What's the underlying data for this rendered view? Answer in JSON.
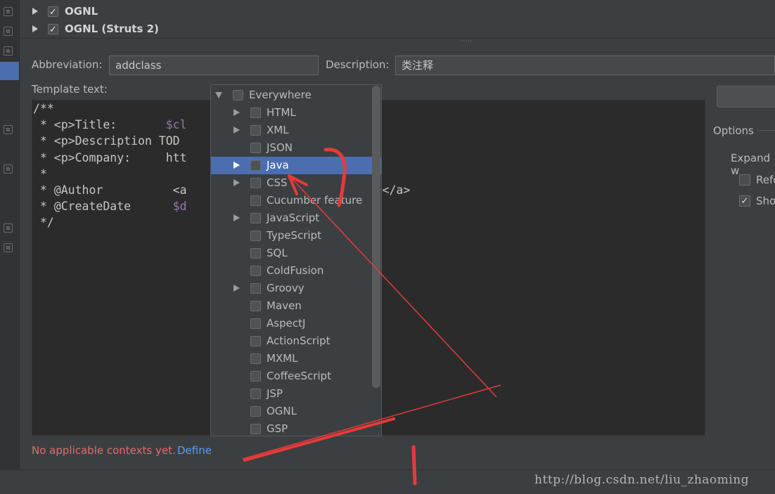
{
  "tree": {
    "items": [
      {
        "label": "OGNL",
        "checked": true
      },
      {
        "label": "OGNL (Struts 2)",
        "checked": true
      }
    ]
  },
  "form": {
    "abbreviation_label": "Abbreviation:",
    "abbreviation_value": "addclass",
    "description_label": "Description:",
    "description_value": "类注释",
    "template_label": "Template text:"
  },
  "editor": {
    "lines": [
      "/**",
      " * <p>Title:       $cl",
      " * <p>Description TOD",
      " * <p>Company:     htt                      </p>",
      " *",
      " * @Author          <a             sina.cn\"/>刘兆明</a>",
      " * @CreateDate      $d",
      " */"
    ],
    "variable_prefix_title": "$cl",
    "variable_prefix_date": "$d"
  },
  "options": {
    "title": "Options",
    "expand_label": "Expand w",
    "reformat_label": "Refo",
    "shorten_label": "Sho"
  },
  "popup": {
    "items": [
      {
        "label": "Everywhere",
        "level": 0,
        "expandable": true,
        "expanded": true,
        "selected": false
      },
      {
        "label": "HTML",
        "level": 1,
        "expandable": true,
        "selected": false
      },
      {
        "label": "XML",
        "level": 1,
        "expandable": true,
        "selected": false
      },
      {
        "label": "JSON",
        "level": 1,
        "expandable": false,
        "selected": false
      },
      {
        "label": "Java",
        "level": 1,
        "expandable": true,
        "selected": true
      },
      {
        "label": "CSS",
        "level": 1,
        "expandable": true,
        "selected": false
      },
      {
        "label": "Cucumber feature",
        "level": 1,
        "expandable": false,
        "selected": false
      },
      {
        "label": "JavaScript",
        "level": 1,
        "expandable": true,
        "selected": false
      },
      {
        "label": "TypeScript",
        "level": 1,
        "expandable": false,
        "selected": false
      },
      {
        "label": "SQL",
        "level": 1,
        "expandable": false,
        "selected": false
      },
      {
        "label": "ColdFusion",
        "level": 1,
        "expandable": false,
        "selected": false
      },
      {
        "label": "Groovy",
        "level": 1,
        "expandable": true,
        "selected": false
      },
      {
        "label": "Maven",
        "level": 1,
        "expandable": false,
        "selected": false
      },
      {
        "label": "AspectJ",
        "level": 1,
        "expandable": false,
        "selected": false
      },
      {
        "label": "ActionScript",
        "level": 1,
        "expandable": false,
        "selected": false
      },
      {
        "label": "MXML",
        "level": 1,
        "expandable": false,
        "selected": false
      },
      {
        "label": "CoffeeScript",
        "level": 1,
        "expandable": false,
        "selected": false
      },
      {
        "label": "JSP",
        "level": 1,
        "expandable": false,
        "selected": false
      },
      {
        "label": "OGNL",
        "level": 1,
        "expandable": false,
        "selected": false
      },
      {
        "label": "GSP",
        "level": 1,
        "expandable": false,
        "selected": false
      }
    ]
  },
  "status": {
    "message": "No applicable contexts yet.",
    "link": "Define"
  },
  "watermark": "http://blog.csdn.net/liu_zhaoming",
  "colors": {
    "background": "#3c3f41",
    "editor_bg": "#2b2b2b",
    "selection": "#4b6eaf",
    "error_text": "#e06c6c",
    "link_text": "#589df6",
    "annotation_red": "#e83a3a",
    "template_variable": "#9876aa"
  }
}
